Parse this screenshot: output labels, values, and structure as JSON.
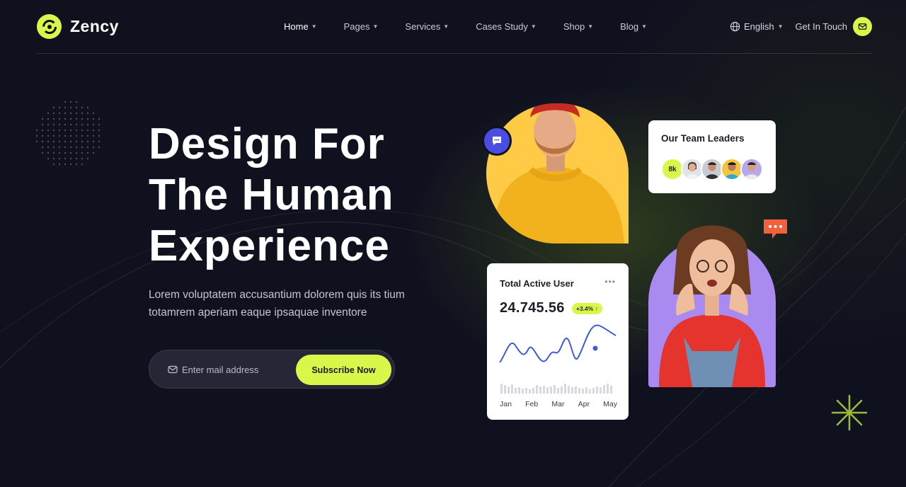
{
  "brand": {
    "name": "Zency",
    "accent": "#d8f74a",
    "background": "#10111f"
  },
  "nav": {
    "items": [
      {
        "label": "Home",
        "active": true
      },
      {
        "label": "Pages",
        "active": false
      },
      {
        "label": "Services",
        "active": false
      },
      {
        "label": "Cases Study",
        "active": false
      },
      {
        "label": "Shop",
        "active": false
      },
      {
        "label": "Blog",
        "active": false
      }
    ],
    "language": "English",
    "cta": "Get In Touch"
  },
  "hero": {
    "title_lines": [
      "Design For",
      "The Human",
      "Experience"
    ],
    "subtitle_lines": [
      "Lorem voluptatem accusantium dolorem quis its tium",
      "totamrem aperiam eaque ipsaquae inventore"
    ],
    "email_placeholder": "Enter mail address",
    "subscribe_label": "Subscribe Now"
  },
  "team": {
    "title": "Our Team Leaders",
    "count": "8k"
  },
  "stats": {
    "title": "Total Active User",
    "more": "•••",
    "value": "24.745.56",
    "growth": "+3.4% ↑",
    "months": [
      "Jan",
      "Feb",
      "Mar",
      "Apr",
      "May"
    ]
  }
}
